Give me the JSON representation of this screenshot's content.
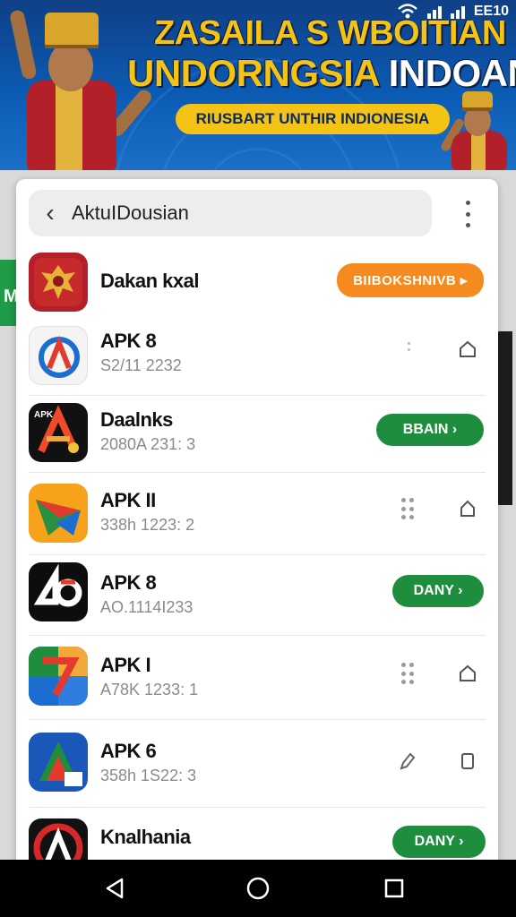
{
  "banner": {
    "headline_line1": "ZASAILA S WBOITIAN I",
    "headline_line2_yellow": "UNDORNGSIA ",
    "headline_line2_white": "INDOANNSIAI",
    "pill_text": "RIUSBART UNTHIR INDIONESIA",
    "status_time": "EE10"
  },
  "search": {
    "title": "AktuIDousian"
  },
  "side_label": "M",
  "apps": [
    {
      "name": "Dakan kxal",
      "sub": "",
      "action": "button",
      "button_label": "BIIBOKSHNIVB ▸",
      "button_color": "#f58a1f",
      "icon": "garuda-icon"
    },
    {
      "name": "APK 8",
      "sub": "S2/11 2232",
      "action": "icons",
      "icon": "apk-blue-logo-icon"
    },
    {
      "name": "Daalnks",
      "sub": "2080A 231: 3",
      "action": "button",
      "button_label": "BBAIN ›",
      "button_color": "#1e8e3e",
      "icon": "apk-dark-logo-icon"
    },
    {
      "name": "APK II",
      "sub": "338h 1223: 2",
      "action": "icons",
      "icon": "apk-orange-logo-icon"
    },
    {
      "name": "APK 8",
      "sub": "AO.1114I233",
      "action": "button",
      "button_label": "DANY ›",
      "button_color": "#1e8e3e",
      "icon": "apk-black-logo-icon"
    },
    {
      "name": "APK I",
      "sub": "A78K 1233: 1",
      "action": "icons",
      "icon": "apk-multicolor-logo-icon"
    },
    {
      "name": "APK 6",
      "sub": "358h 1S22: 3",
      "action": "icons",
      "icon": "apk-triangle-logo-icon"
    },
    {
      "name": "Knalhania",
      "sub": "",
      "action": "button",
      "button_label": "DANY ›",
      "button_color": "#1e8e3e",
      "icon": "apk-red-logo-icon"
    }
  ]
}
